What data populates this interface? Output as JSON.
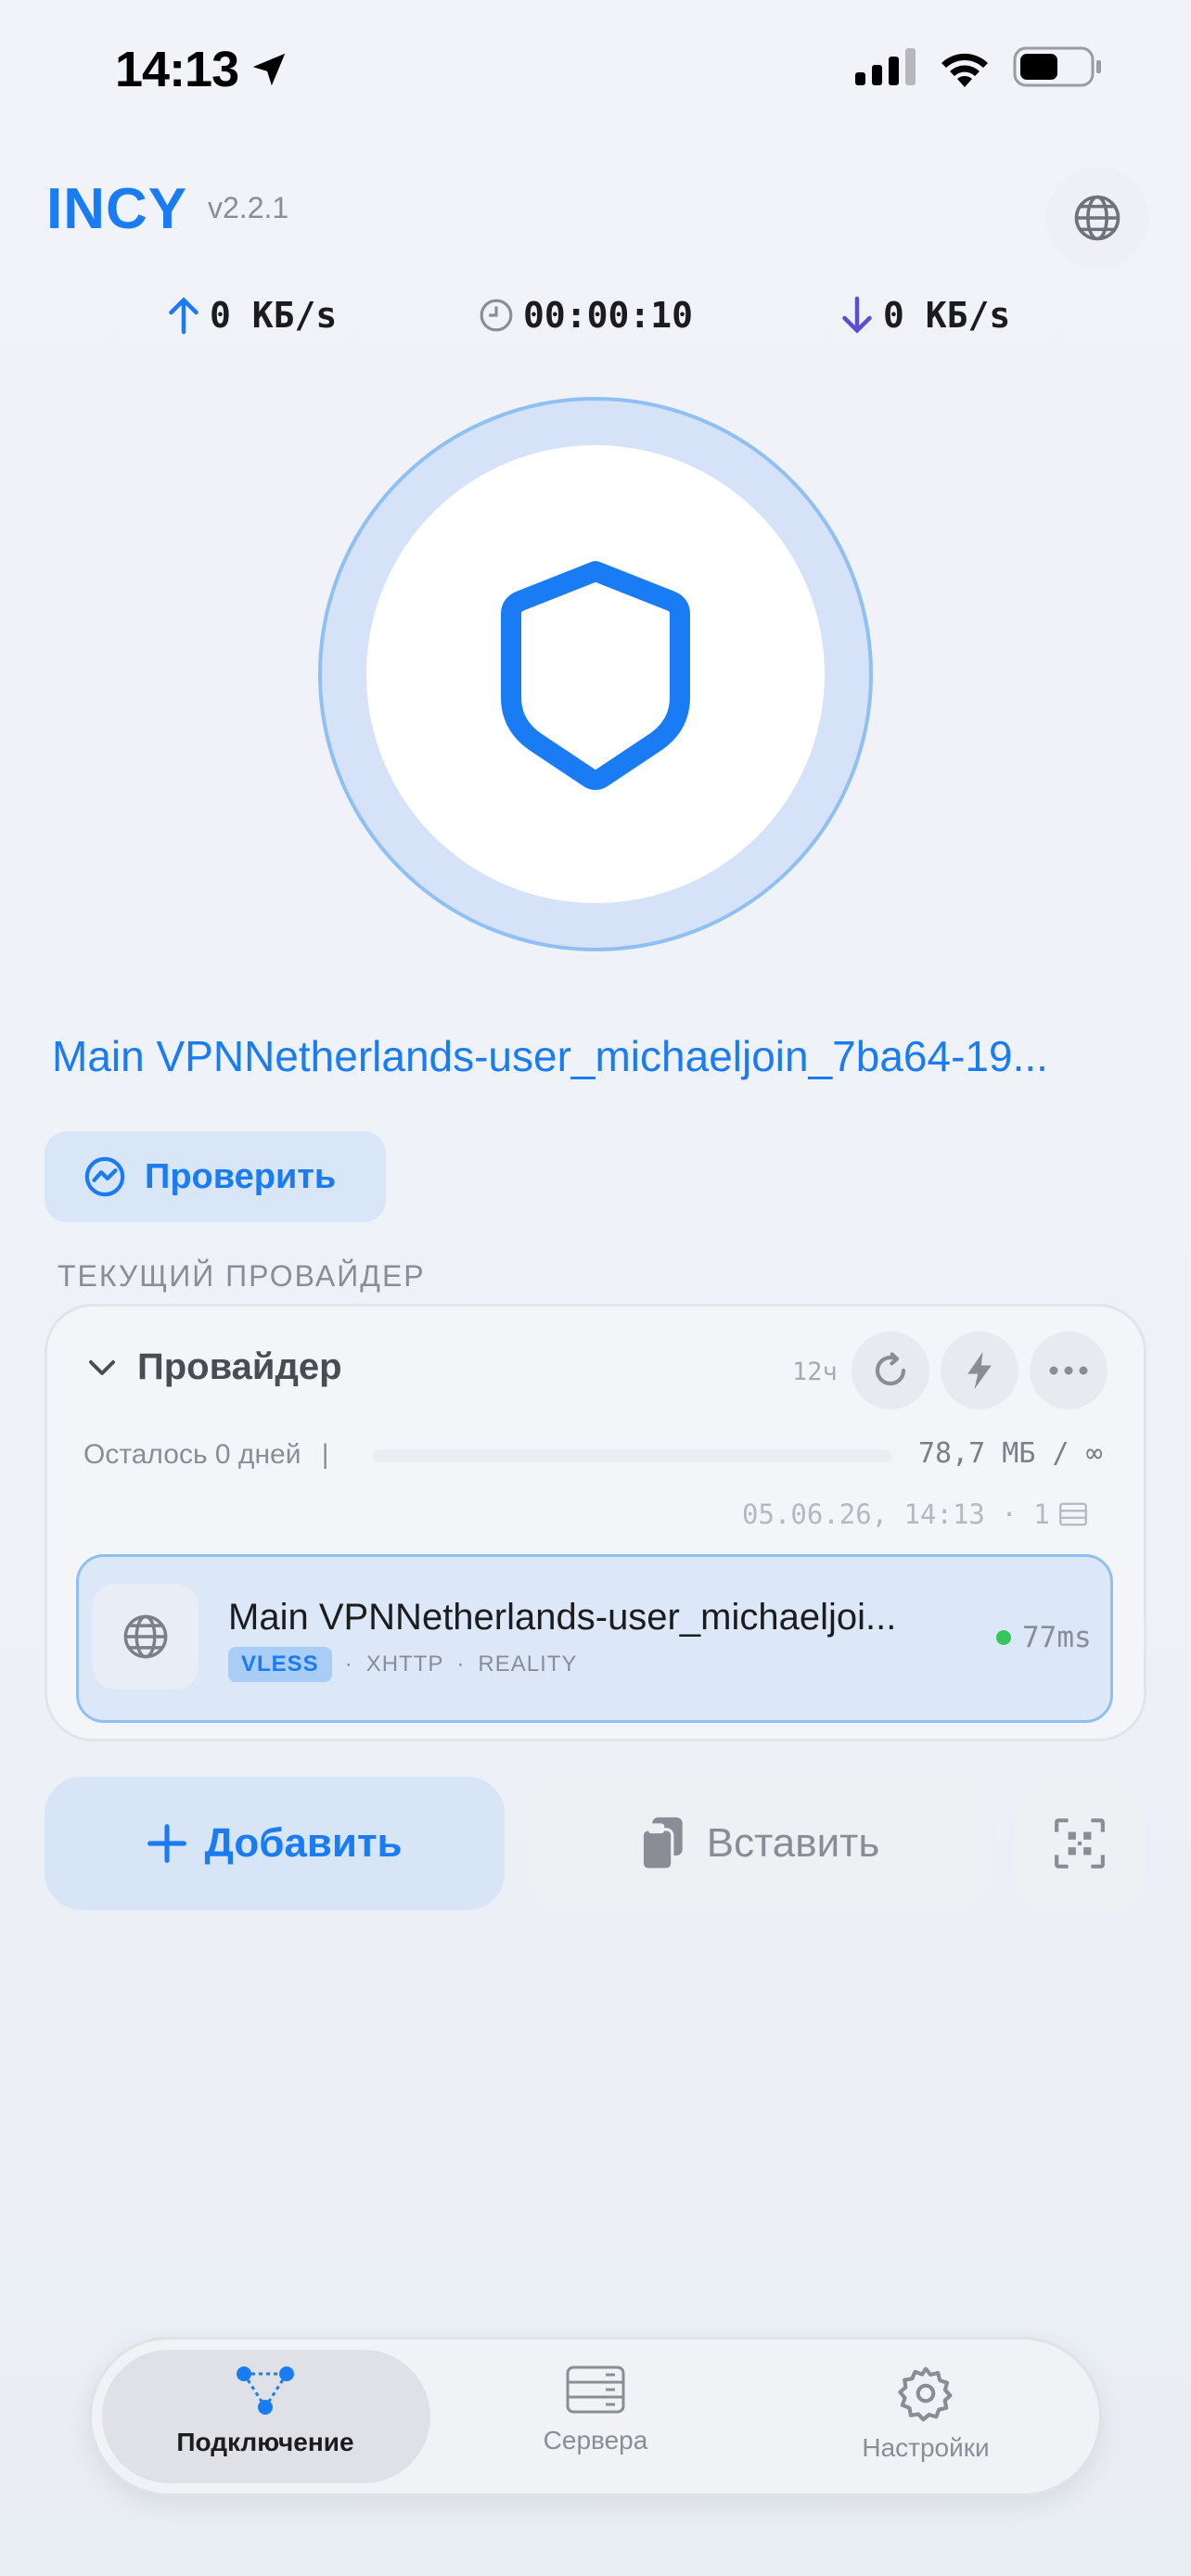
{
  "status_bar": {
    "time": "14:13",
    "icons": [
      "location-arrow-icon",
      "cellular-signal-icon",
      "wifi-icon",
      "battery-icon"
    ]
  },
  "header": {
    "brand": "INCY",
    "version": "v2.2.1",
    "globe_icon": "globe-icon"
  },
  "stats": {
    "upload": "0 КБ/s",
    "duration": "00:00:10",
    "download": "0 КБ/s"
  },
  "connection": {
    "server_name": "Main VPNNetherlands-user_michaeljoin_7ba64-19...",
    "check_label": "Проверить"
  },
  "provider_section": {
    "label": "ТЕКУЩИЙ ПРОВАЙДЕР",
    "title": "Провайдер",
    "update_interval": "12ч",
    "remaining": "Осталось 0 дней",
    "separator": "|",
    "traffic": "78,7 МБ / ∞",
    "traffic_used_fraction": 0,
    "updated": "05.06.26, 14:13 · 1",
    "server": {
      "name": "Main VPNNetherlands-user_michaeljoi...",
      "protocol": "VLESS",
      "transport": "XHTTP",
      "security": "REALITY",
      "dot": "·",
      "ping": "77ms"
    }
  },
  "actions": {
    "add_label": "Добавить",
    "paste_label": "Вставить"
  },
  "tabbar": {
    "tabs": [
      {
        "label": "Подключение",
        "active": true
      },
      {
        "label": "Сервера",
        "active": false
      },
      {
        "label": "Настройки",
        "active": false
      }
    ]
  },
  "colors": {
    "accent": "#1a7cf5",
    "ping_ok": "#34c759",
    "ring": "#8fc0f5"
  }
}
